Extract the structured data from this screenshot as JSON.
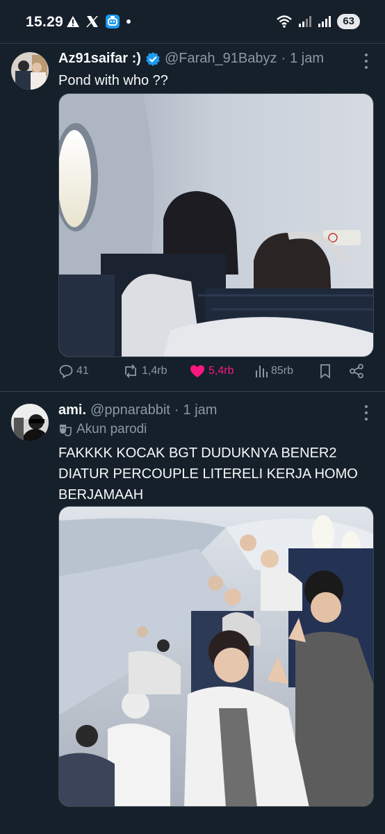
{
  "status_bar": {
    "time": "15.29",
    "battery": "63",
    "left_icons": [
      "warning-icon",
      "x-logo-icon",
      "app-icon",
      "dot-icon"
    ],
    "right_icons": [
      "wifi-icon",
      "signal-icon",
      "signal-icon"
    ]
  },
  "tweets": [
    {
      "display_name": "Az91saifar :)",
      "verified": true,
      "handle": "@Farah_91Babyz",
      "separator": "·",
      "time": "1 jam",
      "text": "Pond with who ??",
      "media_description": "photo",
      "actions": {
        "replies": "41",
        "reposts": "1,4rb",
        "likes": "5,4rb",
        "views": "85rb"
      },
      "liked": true
    },
    {
      "display_name": "ami.",
      "verified": false,
      "handle": "@ppnarabbit",
      "separator": "·",
      "time": "1 jam",
      "label": "Akun parodi",
      "text_lines": [
        "FAKKKK KOCAK BGT DUDUKNYA BENER2",
        "DIATUR PERCOUPLE LITERELI KERJA HOMO",
        "BERJAMAAH"
      ]
    }
  ],
  "colors": {
    "background": "#15202b",
    "text": "#f7f9f9",
    "secondary": "#8b98a5",
    "accent": "#1d9bf0",
    "like": "#f91880",
    "divider": "#38444d"
  }
}
